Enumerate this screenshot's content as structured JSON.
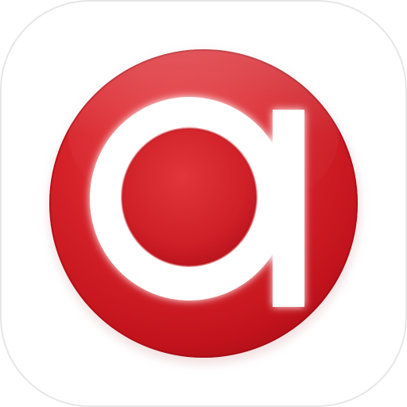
{
  "icon": {
    "name": "letter-a-logo-icon",
    "glyph": "a",
    "colors": {
      "background": "#ffffff",
      "tile_border": "#e6e6e6",
      "disc_light": "#e8383d",
      "disc_mid": "#d41e26",
      "disc_dark": "#b8101a",
      "disc_edge": "#a30d16",
      "glyph_fill": "#ffffff",
      "glow": "#ff9a9a"
    }
  }
}
